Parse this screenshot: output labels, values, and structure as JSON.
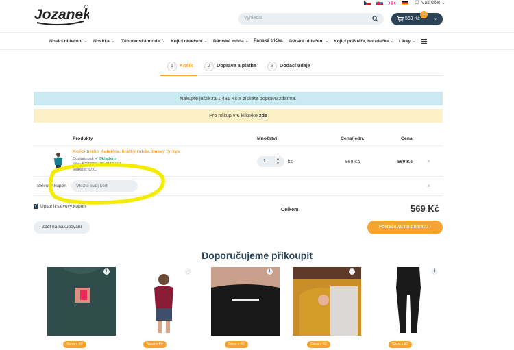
{
  "header": {
    "logo_text": "Jozanek",
    "search_placeholder": "Vyhledat",
    "account_label": "Váš účet",
    "cart_total": "569 Kč",
    "cart_count": "1"
  },
  "nav": {
    "items": [
      {
        "label": "Nosicí oblečení",
        "dropdown": true
      },
      {
        "label": "Nosítka",
        "dropdown": true
      },
      {
        "label": "Těhotenská móda",
        "dropdown": true
      },
      {
        "label": "Kojicí oblečení",
        "dropdown": true
      },
      {
        "label": "Dámská móda",
        "dropdown": true
      },
      {
        "label": "Pánská trička",
        "dropdown": false
      },
      {
        "label": "Dětské oblečení",
        "dropdown": true
      },
      {
        "label": "Kojicí polštáře, hnízdečka",
        "dropdown": true
      },
      {
        "label": "Látky",
        "dropdown": true
      }
    ]
  },
  "steps": [
    {
      "num": "1",
      "label": "Košík",
      "active": true
    },
    {
      "num": "2",
      "label": "Doprava a platba",
      "active": false
    },
    {
      "num": "3",
      "label": "Dodací údaje",
      "active": false
    }
  ],
  "banners": {
    "shipping": "Nakupte ještě za 1 431 Kč a získáte dopravu zdarma.",
    "euro_prefix": "Pro nákup v € klikněte",
    "euro_link": "zde"
  },
  "table": {
    "headers": {
      "product": "Produkty",
      "qty": "Množství",
      "unit_price": "Cena/jedn.",
      "price": "Cena"
    },
    "item": {
      "name": "Kojicí tričko Kateřina, krátký rukáv, tmavý tyrkys",
      "availability_label": "Dostupnost:",
      "availability_value": "✔ Skladem",
      "code": "Kód: KOTR13-KR-TMT-LXL",
      "size": "Velikost: L/XL",
      "qty": "1",
      "unit": "ks",
      "unit_price": "569 Kč",
      "price": "569 Kč"
    }
  },
  "coupon": {
    "label": "Slevový kupón",
    "placeholder": "Vložte svůj kód",
    "apply_label": "Uplatnit slevový kupón"
  },
  "totals": {
    "label": "Celkem",
    "value": "569 Kč"
  },
  "actions": {
    "back": "‹  Zpět na nakupování",
    "next": "Pokračovat na dopravu  ›"
  },
  "recommended": {
    "title": "Doporučujeme přikoupit",
    "badge": "Sleva v Kč",
    "items": [
      "i",
      "i",
      "i",
      "i",
      "i"
    ]
  },
  "colors": {
    "accent": "#f5a431",
    "dark": "#2b4355",
    "info_bg": "#c9eaf1",
    "warn_bg": "#fcf0c7",
    "highlight": "#f4ec00"
  }
}
